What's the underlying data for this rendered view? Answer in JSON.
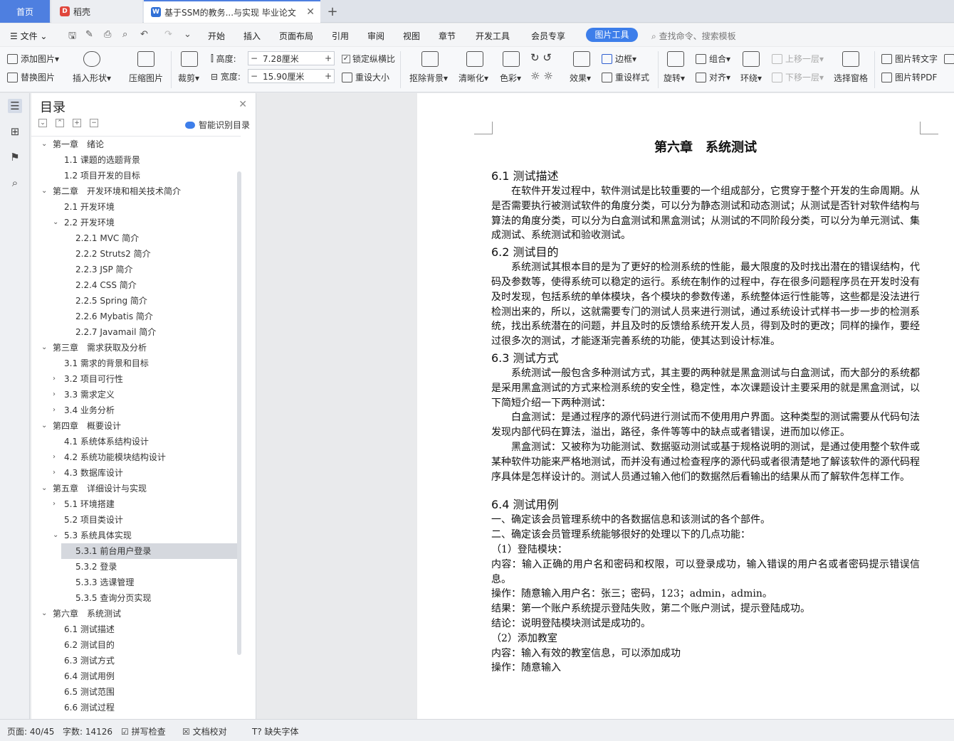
{
  "tabs": {
    "home": "首页",
    "daoke": "稻壳",
    "doc": "基于SSM的教务...与实现 毕业论文",
    "add": "+"
  },
  "menu": {
    "file": "文件",
    "items": [
      "开始",
      "插入",
      "页面布局",
      "引用",
      "审阅",
      "视图",
      "章节",
      "开发工具",
      "会员专享"
    ],
    "active": "图片工具",
    "search": "查找命令、搜索模板"
  },
  "ribbon": {
    "add_pic": "添加图片",
    "replace_pic": "替换图片",
    "insert_shape": "插入形状",
    "compress": "压缩图片",
    "crop": "裁剪",
    "height_label": "高度:",
    "height_value": "7.28厘米",
    "width_label": "宽度:",
    "width_value": "15.90厘米",
    "lock_ratio": "锁定纵横比",
    "reset_size": "重设大小",
    "remove_bg": "抠除背景",
    "sharpen": "清晰化",
    "color": "色彩",
    "effect": "效果",
    "border": "边框",
    "reset_style": "重设样式",
    "rotate": "旋转",
    "combine": "组合",
    "align": "对齐",
    "wrap": "环绕",
    "bring_up": "上移一层",
    "send_down": "下移一层",
    "select_pane": "选择窗格",
    "to_text": "图片转文字",
    "to_pdf": "图片转PDF"
  },
  "toc": {
    "title": "目录",
    "smart": "智能识别目录",
    "items": [
      {
        "label": "第一章　绪论",
        "level": 1,
        "arrow": "v"
      },
      {
        "label": "1.1  课题的选题背景",
        "level": 2,
        "arrow": ""
      },
      {
        "label": "1.2  项目开发的目标",
        "level": 2,
        "arrow": ""
      },
      {
        "label": "第二章　开发环境和相关技术简介",
        "level": 1,
        "arrow": "v"
      },
      {
        "label": "2.1  开发环境",
        "level": 2,
        "arrow": ""
      },
      {
        "label": "2.2  开发环境",
        "level": 2,
        "arrow": "v"
      },
      {
        "label": "2.2.1 MVC 简介",
        "level": 3,
        "arrow": ""
      },
      {
        "label": "2.2.2 Struts2 简介",
        "level": 3,
        "arrow": ""
      },
      {
        "label": "2.2.3 JSP 简介",
        "level": 3,
        "arrow": ""
      },
      {
        "label": "2.2.4 CSS 简介",
        "level": 3,
        "arrow": ""
      },
      {
        "label": "2.2.5 Spring 简介",
        "level": 3,
        "arrow": ""
      },
      {
        "label": "2.2.6 Mybatis 简介",
        "level": 3,
        "arrow": ""
      },
      {
        "label": "2.2.7 Javamail 简介",
        "level": 3,
        "arrow": ""
      },
      {
        "label": "第三章　需求获取及分析",
        "level": 1,
        "arrow": "v"
      },
      {
        "label": "3.1  需求的背景和目标",
        "level": 2,
        "arrow": ""
      },
      {
        "label": "3.2  项目可行性",
        "level": 2,
        "arrow": ">"
      },
      {
        "label": "3.3  需求定义",
        "level": 2,
        "arrow": ">"
      },
      {
        "label": "3.4  业务分析",
        "level": 2,
        "arrow": ">"
      },
      {
        "label": "第四章　概要设计",
        "level": 1,
        "arrow": "v"
      },
      {
        "label": "4.1  系统体系结构设计",
        "level": 2,
        "arrow": ""
      },
      {
        "label": "4.2  系统功能模块结构设计",
        "level": 2,
        "arrow": ">"
      },
      {
        "label": "4.3  数据库设计",
        "level": 2,
        "arrow": ">"
      },
      {
        "label": "第五章　详细设计与实现",
        "level": 1,
        "arrow": "v"
      },
      {
        "label": "5.1  环境搭建",
        "level": 2,
        "arrow": ">"
      },
      {
        "label": "5.2  项目类设计",
        "level": 2,
        "arrow": ""
      },
      {
        "label": "5.3  系统具体实现",
        "level": 2,
        "arrow": "v"
      },
      {
        "label": "5.3.1  前台用户登录",
        "level": 3,
        "arrow": "",
        "selected": true
      },
      {
        "label": "5.3.2  登录",
        "level": 3,
        "arrow": ""
      },
      {
        "label": "5.3.3  选课管理",
        "level": 3,
        "arrow": ""
      },
      {
        "label": "5.3.5  查询分页实现",
        "level": 3,
        "arrow": ""
      },
      {
        "label": "第六章　系统测试",
        "level": 1,
        "arrow": "v"
      },
      {
        "label": "6.1  测试描述",
        "level": 2,
        "arrow": ""
      },
      {
        "label": "6.2  测试目的",
        "level": 2,
        "arrow": ""
      },
      {
        "label": "6.3  测试方式",
        "level": 2,
        "arrow": ""
      },
      {
        "label": "6.4  测试用例",
        "level": 2,
        "arrow": ""
      },
      {
        "label": "6.5  测试范围",
        "level": 2,
        "arrow": ""
      },
      {
        "label": "6.6  测试过程",
        "level": 2,
        "arrow": ""
      }
    ]
  },
  "doc": {
    "chapter": "第六章　系统测试",
    "s1": "6.1 测试描述",
    "p1": "在软件开发过程中，软件测试是比较重要的一个组成部分，它贯穿于整个开发的生命周期。从是否需要执行被测试软件的角度分类，可以分为静态测试和动态测试；从测试是否针对软件结构与算法的角度分类，可以分为白盒测试和黑盒测试；从测试的不同阶段分类，可以分为单元测试、集成测试、系统测试和验收测试。",
    "s2": "6.2 测试目的",
    "p2": "系统测试其根本目的是为了更好的检测系统的性能，最大限度的及时找出潜在的错误结构，代码及参数等，使得系统可以稳定的运行。系统在制作的过程中，存在很多问题程序员在开发时没有及时发现，包括系统的单体模块，各个模块的参数传递，系统整体运行性能等，这些都是没法进行检测出来的，所以，这就需要专门的测试人员来进行测试，通过系统设计式样书一步一步的检测系统，找出系统潜在的问题，并且及时的反馈给系统开发人员，得到及时的更改；同样的操作，要经过很多次的测试，才能逐渐完善系统的功能，使其达到设计标准。",
    "s3": "6.3 测试方式",
    "p3": "系统测试一般包含多种测试方式，其主要的两种就是黑盒测试与白盒测试，而大部分的系统都是采用黑盒测试的方式来检测系统的安全性，稳定性，本次课题设计主要采用的就是黑盒测试，以下简短介绍一下两种测试：",
    "p4": "白盒测试：是通过程序的源代码进行测试而不使用用户界面。这种类型的测试需要从代码句法发现内部代码在算法，溢出，路径，条件等等中的缺点或者错误，进而加以修正。",
    "p5": "黑盒测试：又被称为功能测试、数据驱动测试或基于规格说明的测试，是通过使用整个软件或某种软件功能来严格地测试，而并没有通过检查程序的源代码或者很清楚地了解该软件的源代码程序具体是怎样设计的。测试人员通过输入他们的数据然后看输出的结果从而了解软件怎样工作。",
    "s4": "6.4 测试用例",
    "l1": "一、确定该会员管理系统中的各数据信息和该测试的各个部件。",
    "l2": "二、确定该会员管理系统能够很好的处理以下的几点功能：",
    "l3": "（1）登陆模块：",
    "l4": "内容：输入正确的用户名和密码和权限，可以登录成功，输入错误的用户名或者密码提示错误信息。",
    "l5": "操作：随意输入用户名：张三；密码，123；admin，admin。",
    "l6": "结果：第一个账户系统提示登陆失败，第二个账户测试，提示登陆成功。",
    "l7": "结论：说明登陆模块测试是成功的。",
    "l8": "（2）添加教室",
    "l9": "内容：输入有效的教室信息，可以添加成功",
    "l10": "操作：随意输入"
  },
  "status": {
    "page": "页面: 40/45",
    "words": "字数: 14126",
    "spell": "拼写检查",
    "proof": "文档校对",
    "font": "缺失字体"
  },
  "colors": {
    "accent": "#3d7eea",
    "home_tab": "#4e7fe0",
    "selected_toc": "#d5d8de"
  }
}
